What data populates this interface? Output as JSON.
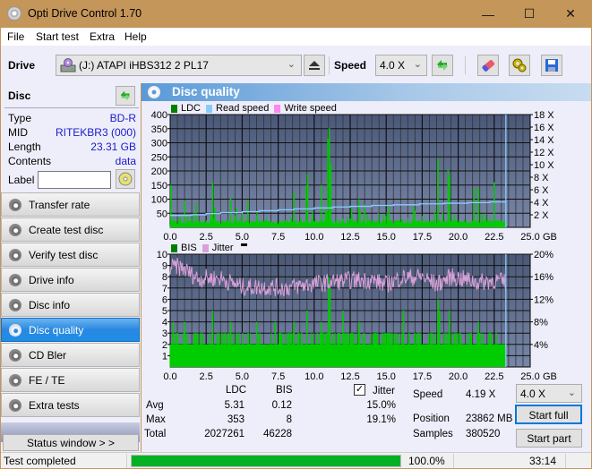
{
  "window": {
    "title": "Opti Drive Control 1.70",
    "minimize_glyph": "—",
    "maximize_glyph": "☐",
    "close_glyph": "✕"
  },
  "menu": [
    "File",
    "Start test",
    "Extra",
    "Help"
  ],
  "toolbar": {
    "drive_label": "Drive",
    "drive_value": "(J:)  ATAPI iHBS312  2 PL17",
    "speed_label": "Speed",
    "speed_value": "4.0 X",
    "chevron": "⌄",
    "icons": [
      "eject-icon",
      "refresh-icon",
      "erase-icon",
      "settings-icon",
      "save-icon"
    ]
  },
  "disc": {
    "heading": "Disc",
    "rows": [
      {
        "key": "Type",
        "value": "BD-R"
      },
      {
        "key": "MID",
        "value": "RITEKBR3 (000)"
      },
      {
        "key": "Length",
        "value": "23.31 GB"
      },
      {
        "key": "Contents",
        "value": "data"
      }
    ],
    "label_key": "Label",
    "label_value": ""
  },
  "nav": [
    {
      "label": "Transfer rate",
      "active": false
    },
    {
      "label": "Create test disc",
      "active": false
    },
    {
      "label": "Verify test disc",
      "active": false
    },
    {
      "label": "Drive info",
      "active": false
    },
    {
      "label": "Disc info",
      "active": false
    },
    {
      "label": "Disc quality",
      "active": true
    },
    {
      "label": "CD Bler",
      "active": false
    },
    {
      "label": "FE / TE",
      "active": false
    },
    {
      "label": "Extra tests",
      "active": false
    }
  ],
  "status_window_label": "Status window > >",
  "panel": {
    "title": "Disc quality"
  },
  "colors": {
    "ldc": "#008000",
    "read_speed": "#88ccff",
    "write_speed": "#ff88ee",
    "bis": "#008000",
    "jitter": "#d8a0d8",
    "bar_fill": "#00cc00",
    "plot_bg_top": "#4a5878",
    "plot_bg_bottom": "#7886a8",
    "accent": "#1e8ee8",
    "progress": "#06b025"
  },
  "chart_data": [
    {
      "type": "bar",
      "title": "LDC / Read speed",
      "legend": [
        "LDC",
        "Read speed",
        "Write speed"
      ],
      "xlabel": "GB",
      "x_ticks": [
        "0.0",
        "2.5",
        "5.0",
        "7.5",
        "10.0",
        "12.5",
        "15.0",
        "17.5",
        "20.0",
        "22.5",
        "25.0"
      ],
      "xlim": [
        0,
        25
      ],
      "y_ticks": [
        "50",
        "100",
        "150",
        "200",
        "250",
        "300",
        "350",
        "400"
      ],
      "ylim": [
        0,
        400
      ],
      "y2_ticks": [
        "2 X",
        "4 X",
        "6 X",
        "8 X",
        "10 X",
        "12 X",
        "14 X",
        "16 X",
        "18 X"
      ],
      "y2lim": [
        0,
        18
      ],
      "disc_end_gb": 23.31,
      "ldc_peaks": [
        {
          "x": 0.05,
          "y": 150
        },
        {
          "x": 1.0,
          "y": 95
        },
        {
          "x": 1.8,
          "y": 85
        },
        {
          "x": 2.95,
          "y": 160
        },
        {
          "x": 3.1,
          "y": 70
        },
        {
          "x": 4.2,
          "y": 105
        },
        {
          "x": 4.6,
          "y": 70
        },
        {
          "x": 5.4,
          "y": 95
        },
        {
          "x": 8.6,
          "y": 125
        },
        {
          "x": 9.55,
          "y": 190
        },
        {
          "x": 9.45,
          "y": 150
        },
        {
          "x": 10.5,
          "y": 150
        },
        {
          "x": 10.95,
          "y": 315
        },
        {
          "x": 11.05,
          "y": 353
        },
        {
          "x": 11.15,
          "y": 225
        },
        {
          "x": 12.6,
          "y": 75
        },
        {
          "x": 13.1,
          "y": 100
        },
        {
          "x": 13.5,
          "y": 80
        },
        {
          "x": 15.2,
          "y": 80
        },
        {
          "x": 16.9,
          "y": 75
        },
        {
          "x": 18.6,
          "y": 245
        },
        {
          "x": 19.3,
          "y": 205
        },
        {
          "x": 19.4,
          "y": 180
        },
        {
          "x": 21.1,
          "y": 140
        },
        {
          "x": 21.4,
          "y": 140
        },
        {
          "x": 22.5,
          "y": 160
        }
      ],
      "ldc_baseline": 20,
      "read_speed_x": [
        0,
        1.5,
        2.5,
        3.5,
        5.0,
        6.2,
        7.5,
        8.6,
        10.0,
        11.3,
        12.5,
        14.0,
        15.5,
        17.3,
        19.0,
        20.7,
        22.2,
        23.3
      ],
      "read_speed_y": [
        1.9,
        2.0,
        2.2,
        2.35,
        2.5,
        2.65,
        2.8,
        2.95,
        3.1,
        3.25,
        3.35,
        3.5,
        3.6,
        3.75,
        3.85,
        3.95,
        4.05,
        4.19
      ]
    },
    {
      "type": "bar",
      "title": "BIS / Jitter",
      "legend": [
        "BIS",
        "Jitter"
      ],
      "xlabel": "GB",
      "x_ticks": [
        "0.0",
        "2.5",
        "5.0",
        "7.5",
        "10.0",
        "12.5",
        "15.0",
        "17.5",
        "20.0",
        "22.5",
        "25.0"
      ],
      "xlim": [
        0,
        25
      ],
      "y_ticks": [
        "1",
        "2",
        "3",
        "4",
        "5",
        "6",
        "7",
        "8",
        "9",
        "10"
      ],
      "ylim": [
        0,
        10
      ],
      "y2_ticks": [
        "4%",
        "8%",
        "12%",
        "16%",
        "20%"
      ],
      "y2lim": [
        0,
        20
      ],
      "disc_end_gb": 23.31,
      "bis_baseline": 2,
      "bis_peaks": [
        {
          "x": 0.2,
          "y": 4
        },
        {
          "x": 1.0,
          "y": 4
        },
        {
          "x": 2.95,
          "y": 5
        },
        {
          "x": 4.2,
          "y": 4
        },
        {
          "x": 6.0,
          "y": 4
        },
        {
          "x": 7.3,
          "y": 4
        },
        {
          "x": 8.6,
          "y": 4
        },
        {
          "x": 9.5,
          "y": 5
        },
        {
          "x": 10.5,
          "y": 4
        },
        {
          "x": 11.0,
          "y": 8
        },
        {
          "x": 11.1,
          "y": 7
        },
        {
          "x": 12.0,
          "y": 5
        },
        {
          "x": 13.1,
          "y": 4
        },
        {
          "x": 16.2,
          "y": 5
        },
        {
          "x": 18.6,
          "y": 6
        },
        {
          "x": 18.7,
          "y": 5
        },
        {
          "x": 19.4,
          "y": 5
        },
        {
          "x": 21.4,
          "y": 4
        }
      ],
      "jitter_trend_x": [
        0,
        0.5,
        1.0,
        1.5,
        2.0,
        2.5,
        3.5,
        5.0,
        6.5,
        8.0,
        9.5,
        11.0,
        12.5,
        14.0,
        15.0,
        16.0,
        17.5,
        18.5,
        19.5,
        20.5,
        21.5,
        22.5,
        23.3
      ],
      "jitter_trend_y": [
        17.5,
        17.8,
        17.3,
        16.4,
        15.6,
        15.8,
        15.7,
        14.2,
        14.2,
        14.0,
        14.6,
        15.0,
        15.4,
        15.4,
        14.6,
        15.8,
        16.0,
        14.6,
        16.0,
        15.5,
        15.0,
        15.4,
        15.0
      ]
    }
  ],
  "stats": {
    "col_ldc": "LDC",
    "col_bis": "BIS",
    "jitter_label": "Jitter",
    "jitter_checked": true,
    "rows": [
      {
        "label": "Avg",
        "ldc": "5.31",
        "bis": "0.12",
        "jitter": "15.0%"
      },
      {
        "label": "Max",
        "ldc": "353",
        "bis": "8",
        "jitter": "19.1%"
      },
      {
        "label": "Total",
        "ldc": "2027261",
        "bis": "46228",
        "jitter": ""
      }
    ],
    "speed_label": "Speed",
    "speed_value": "4.19 X",
    "position_label": "Position",
    "position_value": "23862 MB",
    "samples_label": "Samples",
    "samples_value": "380520",
    "speed_select": "4.0 X",
    "start_full": "Start full",
    "start_part": "Start part"
  },
  "statusbar": {
    "text": "Test completed",
    "progress": 1.0,
    "progress_label": "100.0%",
    "elapsed": "33:14"
  }
}
